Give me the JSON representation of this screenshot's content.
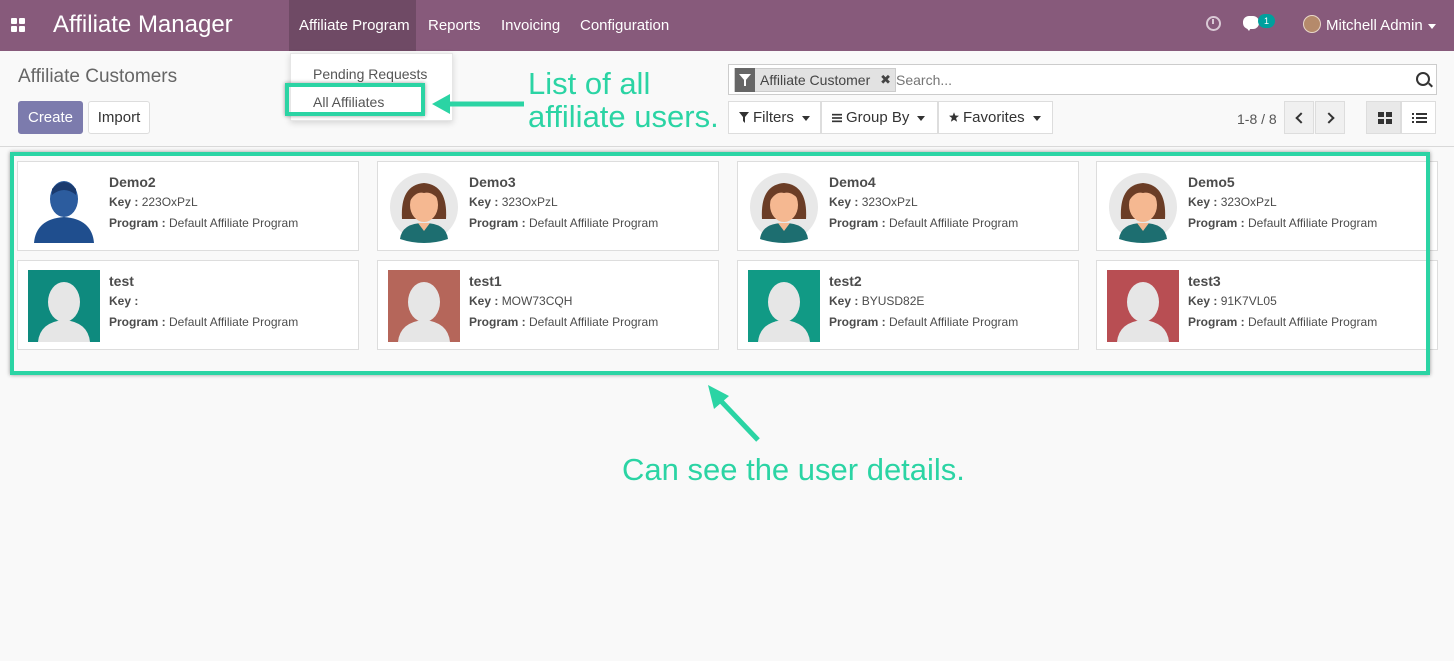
{
  "navbar": {
    "brand": "Affiliate Manager",
    "menu": [
      "Affiliate Program",
      "Reports",
      "Invoicing",
      "Configuration"
    ],
    "chat_count": "1",
    "user": "Mitchell Admin"
  },
  "dropdown": {
    "items": [
      "Pending Requests",
      "All Affiliates"
    ]
  },
  "control_panel": {
    "title": "Affiliate Customers",
    "create_label": "Create",
    "import_label": "Import",
    "search_facet": "Affiliate Customer",
    "search_placeholder": "Search...",
    "filters_label": "Filters",
    "groupby_label": "Group By",
    "favorites_label": "Favorites",
    "pager": "1-8 / 8"
  },
  "kanban": {
    "key_label": "Key :",
    "program_label": "Program :",
    "cards": [
      {
        "name": "Demo2",
        "key": "223OxPzL",
        "program": "Default Affiliate Program",
        "avatar": "male-blue"
      },
      {
        "name": "Demo3",
        "key": "323OxPzL",
        "program": "Default Affiliate Program",
        "avatar": "female"
      },
      {
        "name": "Demo4",
        "key": "323OxPzL",
        "program": "Default Affiliate Program",
        "avatar": "female"
      },
      {
        "name": "Demo5",
        "key": "323OxPzL",
        "program": "Default Affiliate Program",
        "avatar": "female"
      },
      {
        "name": "test",
        "key": "",
        "program": "Default Affiliate Program",
        "avatar": "placeholder",
        "color": "#0e8a7e"
      },
      {
        "name": "test1",
        "key": "MOW73CQH",
        "program": "Default Affiliate Program",
        "avatar": "placeholder",
        "color": "#b5665a"
      },
      {
        "name": "test2",
        "key": "BYUSD82E",
        "program": "Default Affiliate Program",
        "avatar": "placeholder",
        "color": "#119a85"
      },
      {
        "name": "test3",
        "key": "91K7VL05",
        "program": "Default Affiliate Program",
        "avatar": "placeholder",
        "color": "#b84e53"
      }
    ]
  },
  "annotations": {
    "menu_note_line1": "List of all",
    "menu_note_line2": "affiliate users.",
    "cards_note": "Can see the user details.",
    "accent": "#2bd4a4"
  }
}
